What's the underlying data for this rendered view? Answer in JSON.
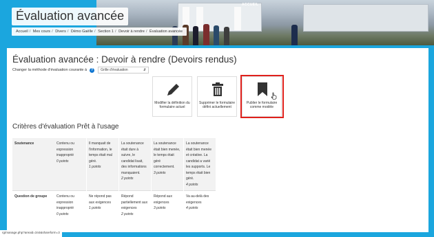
{
  "banner": {
    "title": "Évaluation avancée",
    "accueil_label": "ACCUEIL",
    "breadcrumb": [
      "Accueil",
      "Mes cours",
      "Divers",
      "Démo Gaëlle",
      "Section 1",
      "Devoir à rendre",
      "Évaluation avancée"
    ]
  },
  "page": {
    "heading": "Évaluation avancée : Devoir à rendre (Devoirs rendus)",
    "method_label": "Changer la méthode d'évaluation courante à",
    "method_value": "Grille d'évaluation"
  },
  "actions": [
    {
      "label": "Modifier la définition du formulaire actuel",
      "icon": "pencil-icon"
    },
    {
      "label": "Supprimer le formulaire défini actuellement",
      "icon": "trash-icon"
    },
    {
      "label": "Publier le formulaire comme modèle",
      "icon": "bookmark-icon"
    }
  ],
  "rubric": {
    "title": "Critères d'évaluation Prêt à l'usage",
    "criteria": [
      {
        "name": "Soutenance",
        "levels": [
          {
            "text": "Contenu ou expression inapproprié",
            "points": "0 points"
          },
          {
            "text": "Il manquait de l'information, le temps était mal géré.",
            "points": "1 points"
          },
          {
            "text": "La soutenance était dure à suivre, le candidat lisait, des informations manquaient.",
            "points": "2 points"
          },
          {
            "text": "La soutenance était bien menée, le temps était géré correctement.",
            "points": "3 points"
          },
          {
            "text": "La soutenance était bien menée et créative. La candidat a varié les supports. Le temps était bien géré.",
            "points": "4 points"
          }
        ]
      },
      {
        "name": "Question de groupe",
        "levels": [
          {
            "text": "Contenu ou expression inapproprié",
            "points": "0 points"
          },
          {
            "text": "Ne répond pas aux exigences",
            "points": "1 points"
          },
          {
            "text": "Répond partiellement aux exigences",
            "points": "2 points"
          },
          {
            "text": "Répond aux exigences",
            "points": "3 points"
          },
          {
            "text": "Va au-delà des exigences",
            "points": "4 points"
          }
        ]
      }
    ]
  },
  "status_url": "rg/manage.php?areaid=344&shareform=3",
  "colors": {
    "brand": "#1ba6de",
    "highlight": "#e0201b",
    "help": "#1177d1"
  }
}
